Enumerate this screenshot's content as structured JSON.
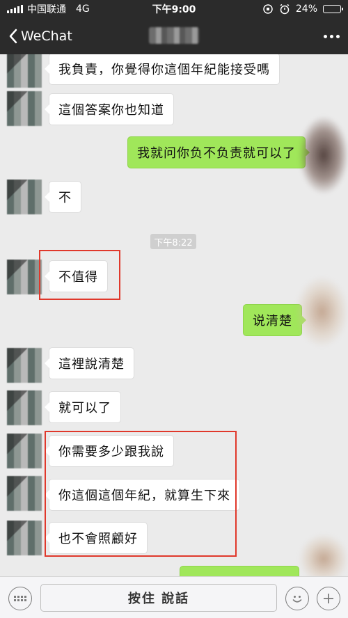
{
  "status_bar": {
    "carrier": "中国联通",
    "network": "4G",
    "time": "下午9:00",
    "battery_text": "24%",
    "battery_level": 0.24
  },
  "nav": {
    "back_label": "WeChat",
    "title": ""
  },
  "messages": {
    "m1": "我負責，你覺得你這個年紀能接受嗎",
    "m2": "這個答案你也知道",
    "m3": "我就问你负不负责就可以了",
    "m4": "不",
    "timestamp": "下午8:22",
    "m5": "不值得",
    "m6": "说清楚",
    "m7": "這裡說清楚",
    "m8": "就可以了",
    "m9": "你需要多少跟我說",
    "m10": "你這個這個年紀，就算生下來",
    "m11": "也不會照顧好",
    "m12": ""
  },
  "input_bar": {
    "hold_to_talk": "按住 說話"
  },
  "colors": {
    "incoming_bubble": "#ffffff",
    "outgoing_bubble": "#a0e75a",
    "chat_background": "#ebebeb",
    "highlight_box": "#e0382b",
    "header_background": "#2b2b2b"
  }
}
